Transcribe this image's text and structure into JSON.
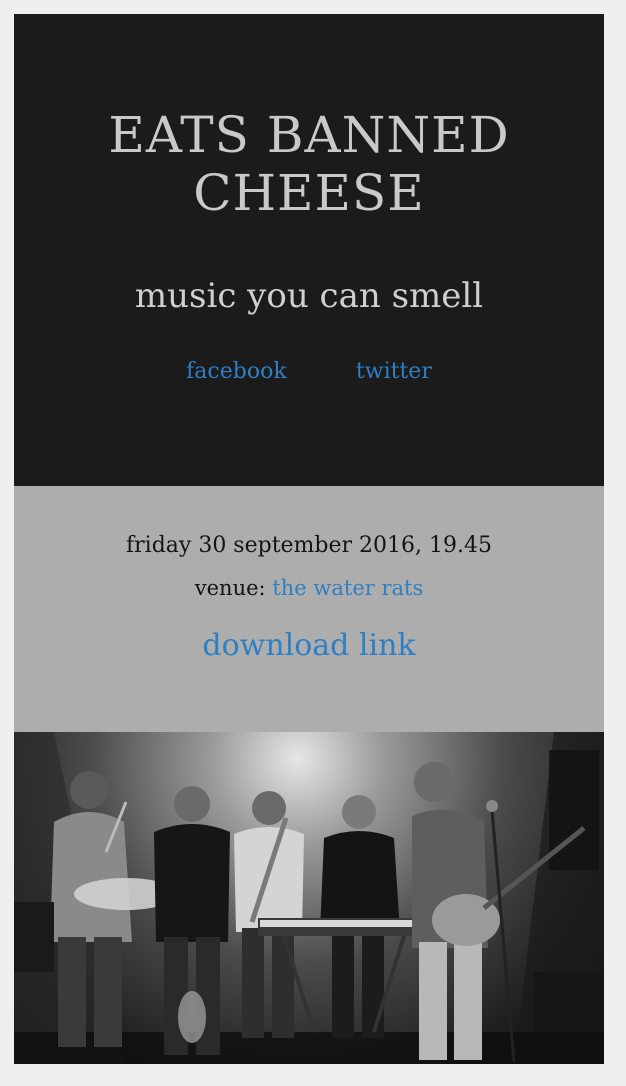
{
  "hero": {
    "band_name_line1": "EATS BANNED",
    "band_name_line2": "CHEESE",
    "tagline": "music you can smell",
    "links": {
      "facebook": "facebook",
      "twitter": "twitter"
    }
  },
  "gig": {
    "date": "friday 30 september 2016, 19.45",
    "venue_label": "venue:",
    "venue_name": "the water rats",
    "download_label": "download link"
  },
  "photo": {
    "alt": ""
  },
  "colors": {
    "hero_bg": "#1b1b1c",
    "gig_bg": "#adadad",
    "link": "#2f7fc4",
    "heading_text": "#c9c9c9"
  }
}
